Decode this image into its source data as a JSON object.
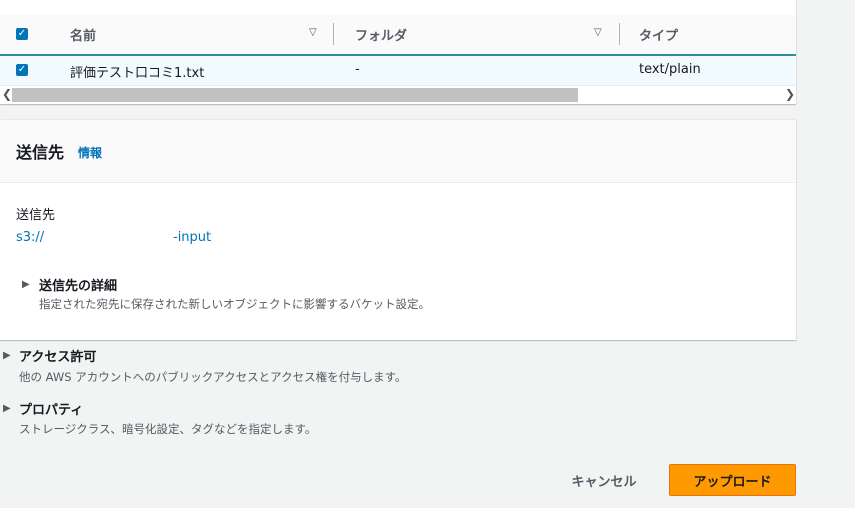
{
  "files_table": {
    "columns": [
      {
        "label": "名前",
        "sort_icon": "sort-descending-icon"
      },
      {
        "label": "フォルダ",
        "sort_icon": "sort-descending-icon"
      },
      {
        "label": "タイプ"
      }
    ],
    "rows": [
      {
        "checked": true,
        "name": "評価テスト口コミ1.txt",
        "folder": "-",
        "type": "text/plain"
      }
    ],
    "select_all_checked": true
  },
  "destination": {
    "heading": "送信先",
    "info_link": "情報",
    "label": "送信先",
    "s3_prefix": "s3://",
    "s3_suffix": "-input",
    "details": {
      "title": "送信先の詳細",
      "description": "指定された宛先に保存された新しいオブジェクトに影響するバケット設定。"
    }
  },
  "sections": [
    {
      "title": "アクセス許可",
      "description": "他の AWS アカウントへのパブリックアクセスとアクセス権を付与します。"
    },
    {
      "title": "プロパティ",
      "description": "ストレージクラス、暗号化設定、タグなどを指定します。"
    }
  ],
  "actions": {
    "cancel": "キャンセル",
    "upload": "アップロード"
  },
  "colors": {
    "accent": "#0073bb",
    "primary_button": "#ff9900",
    "selected_row": "#f1faff"
  }
}
